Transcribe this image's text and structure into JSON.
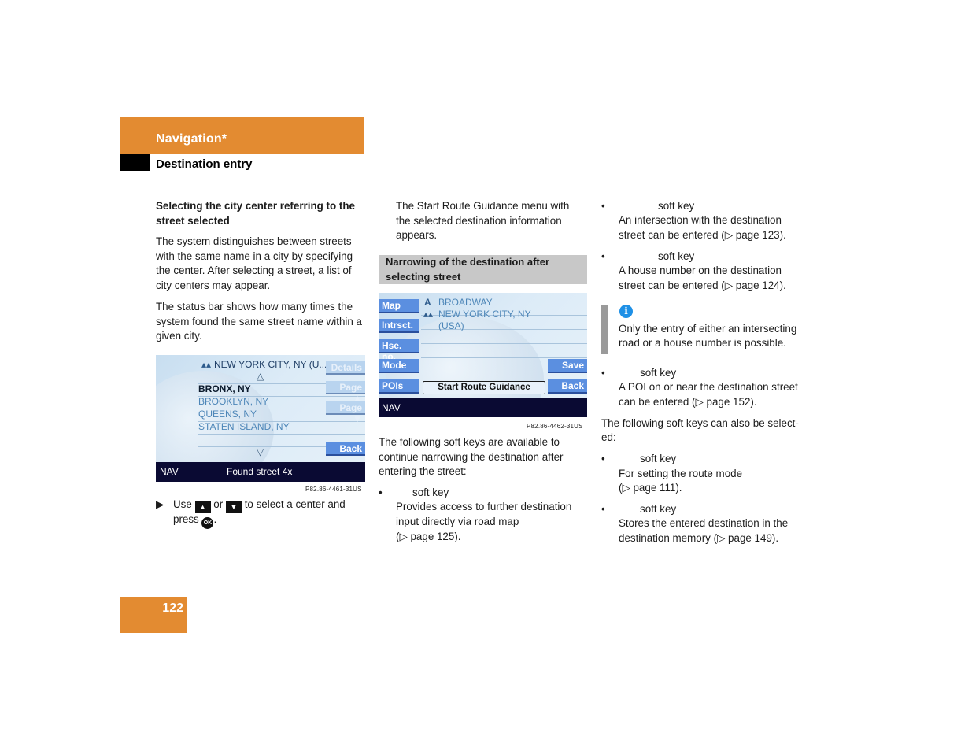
{
  "header": {
    "chapter": "Navigation*",
    "section": "Destination entry",
    "accent_color": "#e38b31"
  },
  "col1": {
    "heading": "Selecting the city center referring to the street selected",
    "para1": "The system distinguishes between streets with the same name in a city by specifying the center. After selecting a street, a list of city centers may appear.",
    "para2": "The status bar shows how many times the system found the same street name within a given city.",
    "screen1": {
      "city_line": "NEW YORK CITY, NY (U...",
      "up_arrow": "△",
      "down_arrow": "▽",
      "items": [
        "BRONX, NY",
        "BROOKLYN, NY",
        "QUEENS, NY",
        "STATEN ISLAND, NY"
      ],
      "selected_index": 0,
      "softkeys": {
        "details": "Details",
        "page_up": "Page ▲",
        "page_down": "Page ▼",
        "back": "Back"
      },
      "status_left": "NAV",
      "status_text": "Found street 4x",
      "figure_code": "P82.86-4461-31US"
    },
    "instruction": {
      "arrow": "▶",
      "use": "Use",
      "key_up": "▲",
      "or": "or",
      "key_down": "▼",
      "rest": "to select a center and",
      "press": "press",
      "ok": "OK",
      "end": "."
    }
  },
  "col2": {
    "intro": "The Start Route Guidance menu with the selected destination information appears.",
    "section_heading": "Narrowing of the destination after selecting street",
    "screen2": {
      "street": "BROADWAY",
      "city": "NEW YORK CITY, NY",
      "country": "(USA)",
      "left_softkeys": [
        "Map",
        "Intrsct.",
        "Hse. no.",
        "Mode",
        "POIs"
      ],
      "save": "Save",
      "back": "Back",
      "center_button": "Start Route Guidance",
      "status_left": "NAV",
      "figure_code": "P82.86-4462-31US"
    },
    "para": "The following soft keys are available to continue narrowing the destination after entering the street:",
    "bullet_map": {
      "label": "soft key",
      "desc1": "Provides access to further destination",
      "desc2": "input directly via road map",
      "desc3": "(▷ page 125)."
    }
  },
  "col3": {
    "bullet_intrsct": {
      "label": "soft key",
      "desc1": "An intersection with the destination",
      "desc2": "street can be entered (▷ page 123)."
    },
    "bullet_hse": {
      "label": "soft key",
      "desc1": "A house number on the destination",
      "desc2": "street can be entered (▷ page 124)."
    },
    "info": {
      "icon": "i",
      "text1": "Only the entry of either an intersecting",
      "text2": "road or a house number is possible."
    },
    "bullet_pois": {
      "label": "soft key",
      "desc1": "A POI on or near the destination street",
      "desc2": "can be entered (▷ page 152)."
    },
    "para1": "The following soft keys can also be select-",
    "para2": "ed:",
    "bullet_mode": {
      "label": "soft key",
      "desc1": "For setting the route mode",
      "desc2": "(▷ page 111)."
    },
    "bullet_save": {
      "label": "soft key",
      "desc1": "Stores the entered destination in the",
      "desc2": "destination memory (▷ page 149)."
    },
    "bullet_glyph": "•"
  },
  "footer": {
    "page_number": "122"
  }
}
